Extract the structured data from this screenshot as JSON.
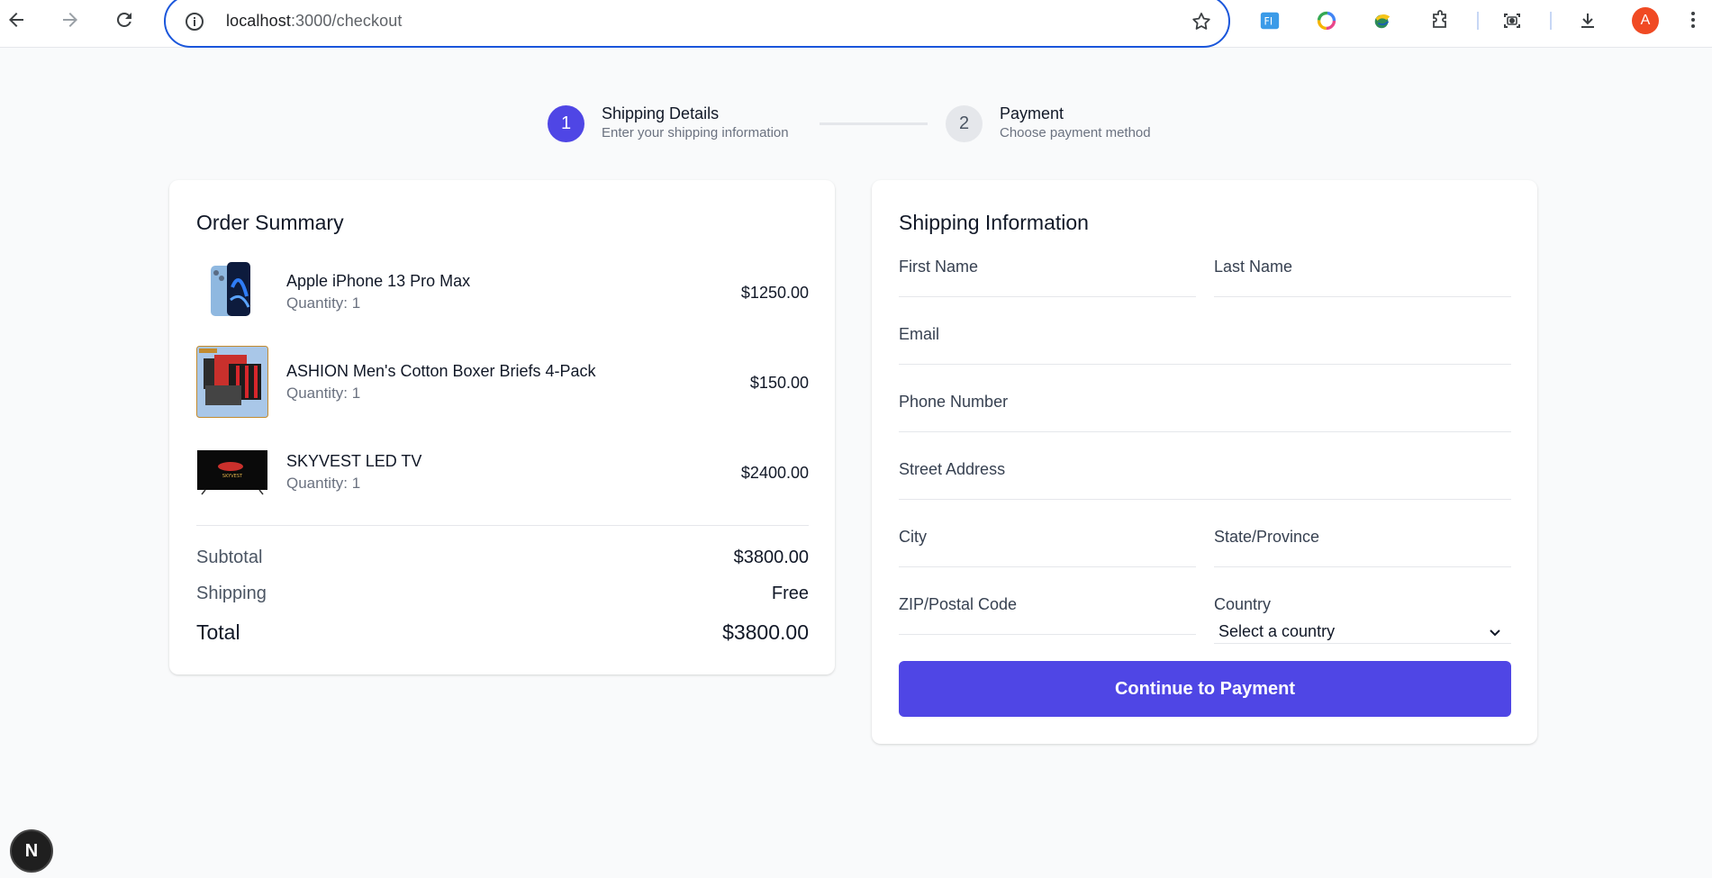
{
  "browser": {
    "url_host": "localhost",
    "url_path": ":3000/checkout",
    "avatar_letter": "A",
    "extensions": [
      "fi-extension-icon",
      "color-wheel-icon",
      "globe-extension-icon",
      "puzzle-icon",
      "screenshot-icon",
      "download-icon"
    ]
  },
  "stepper": {
    "steps": [
      {
        "number": "1",
        "title": "Shipping Details",
        "subtitle": "Enter your shipping information",
        "active": true
      },
      {
        "number": "2",
        "title": "Payment",
        "subtitle": "Choose payment method",
        "active": false
      }
    ]
  },
  "order_summary": {
    "title": "Order Summary",
    "items": [
      {
        "name": "Apple iPhone 13 Pro Max",
        "quantity": "Quantity: 1",
        "price": "$1250.00",
        "thumb": "phone"
      },
      {
        "name": "ASHION Men's Cotton Boxer Briefs 4-Pack",
        "quantity": "Quantity: 1",
        "price": "$150.00",
        "thumb": "boxers"
      },
      {
        "name": "SKYVEST LED TV",
        "quantity": "Quantity: 1",
        "price": "$2400.00",
        "thumb": "tv"
      }
    ],
    "subtotal_label": "Subtotal",
    "subtotal_value": "$3800.00",
    "shipping_label": "Shipping",
    "shipping_value": "Free",
    "total_label": "Total",
    "total_value": "$3800.00"
  },
  "shipping_form": {
    "title": "Shipping Information",
    "first_name_label": "First Name",
    "last_name_label": "Last Name",
    "email_label": "Email",
    "phone_label": "Phone Number",
    "street_label": "Street Address",
    "city_label": "City",
    "state_label": "State/Province",
    "zip_label": "ZIP/Postal Code",
    "country_label": "Country",
    "country_selected": "Select a country",
    "submit_label": "Continue to Payment"
  },
  "dev_badge": "N",
  "colors": {
    "accent": "#4f46e5",
    "page_bg": "#f9fafb",
    "omnibox_border": "#1a56db",
    "avatar": "#f04a23"
  }
}
